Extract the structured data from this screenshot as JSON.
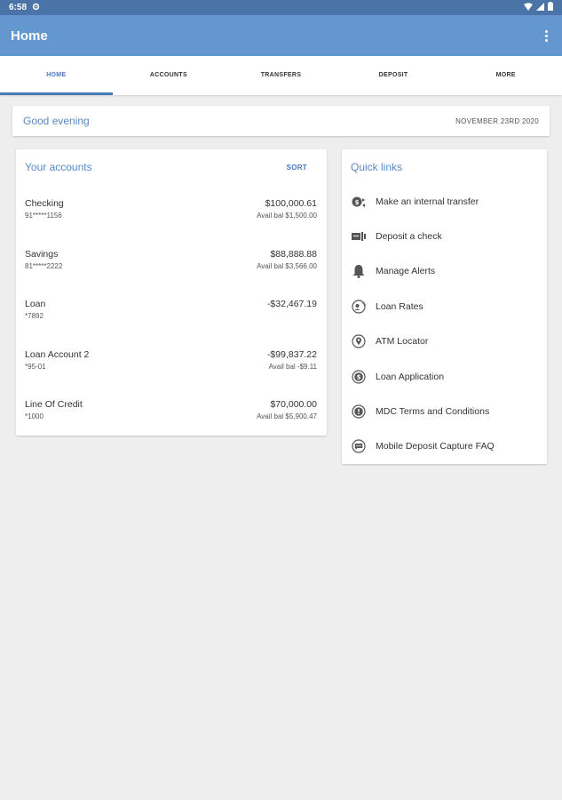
{
  "status_bar": {
    "time": "6:58"
  },
  "app_bar": {
    "title": "Home"
  },
  "tabs": [
    {
      "label": "HOME",
      "active": true
    },
    {
      "label": "ACCOUNTS"
    },
    {
      "label": "TRANSFERS"
    },
    {
      "label": "DEPOSIT"
    },
    {
      "label": "MORE"
    }
  ],
  "greeting": {
    "text": "Good evening",
    "date": "NOVEMBER 23RD 2020"
  },
  "accounts": {
    "title": "Your accounts",
    "sort_label": "SORT",
    "items": [
      {
        "name": "Checking",
        "number": "91*****1156",
        "balance": "$100,000.61",
        "available": "Avail bal $1,500.00"
      },
      {
        "name": "Savings",
        "number": "81*****2222",
        "balance": "$88,888.88",
        "available": "Avail bal $3,566.00"
      },
      {
        "name": "Loan",
        "number": "*7892",
        "balance": "-$32,467.19",
        "available": ""
      },
      {
        "name": "Loan Account 2",
        "number": "*95-01",
        "balance": "-$99,837.22",
        "available": "Avail bal -$9.11"
      },
      {
        "name": "Line Of Credit",
        "number": "*1000",
        "balance": "$70,000.00",
        "available": "Avail bal $5,900.47"
      }
    ]
  },
  "quick_links": {
    "title": "Quick links",
    "items": [
      {
        "label": "Make an internal transfer",
        "icon": "transfer-icon"
      },
      {
        "label": "Deposit a check",
        "icon": "check-icon"
      },
      {
        "label": "Manage Alerts",
        "icon": "bell-icon"
      },
      {
        "label": "Loan Rates",
        "icon": "loan-rates-icon"
      },
      {
        "label": "ATM Locator",
        "icon": "location-pin-icon"
      },
      {
        "label": "Loan Application",
        "icon": "dollar-icon"
      },
      {
        "label": "MDC Terms and Conditions",
        "icon": "info-icon"
      },
      {
        "label": "Mobile Deposit Capture FAQ",
        "icon": "chat-icon"
      }
    ]
  },
  "colors": {
    "status_bar": "#4a74a8",
    "app_bar": "#6497cf",
    "accent": "#4a7ab7",
    "background": "#eeeeee"
  }
}
